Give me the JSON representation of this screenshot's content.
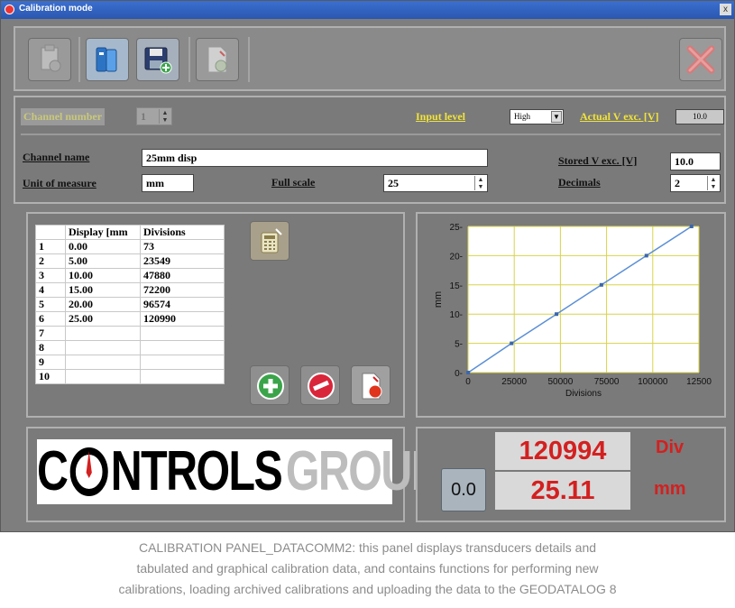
{
  "window": {
    "title": "Calibration mode",
    "close_glyph": "x"
  },
  "toolbar": {
    "buttons": [
      {
        "name": "calibration-sheet-icon",
        "enabled": false
      },
      {
        "name": "archive-folder-icon",
        "enabled": true
      },
      {
        "name": "save-disk-icon",
        "enabled": true
      },
      {
        "name": "upload-document-icon",
        "enabled": false
      },
      {
        "name": "close-x-icon",
        "enabled": false
      }
    ]
  },
  "params": {
    "channel_number_label": "Channel number",
    "channel_number_value": "1",
    "input_level_label": "Input level",
    "input_level_value": "High",
    "actual_vexc_label": "Actual V exc. [V]",
    "actual_vexc_value": "10.0",
    "channel_name_label": "Channel name",
    "channel_name_value": "25mm disp",
    "unit_label": "Unit of measure",
    "unit_value": "mm",
    "full_scale_label": "Full scale",
    "full_scale_value": "25",
    "stored_vexc_label": "Stored V exc. [V]",
    "stored_vexc_value": "10.0",
    "decimals_label": "Decimals",
    "decimals_value": "2"
  },
  "table": {
    "headers": [
      "",
      "Display [mm",
      "Divisions"
    ],
    "rows": [
      [
        "1",
        "0.00",
        "73"
      ],
      [
        "2",
        "5.00",
        "23549"
      ],
      [
        "3",
        "10.00",
        "47880"
      ],
      [
        "4",
        "15.00",
        "72200"
      ],
      [
        "5",
        "20.00",
        "96574"
      ],
      [
        "6",
        "25.00",
        "120990"
      ],
      [
        "7",
        "",
        ""
      ],
      [
        "8",
        "",
        ""
      ],
      [
        "9",
        "",
        ""
      ],
      [
        "10",
        "",
        ""
      ]
    ]
  },
  "chart_data": {
    "type": "line",
    "x": [
      73,
      23549,
      47880,
      72200,
      96574,
      120990
    ],
    "y": [
      0,
      5,
      10,
      15,
      20,
      25
    ],
    "xlabel": "Divisions",
    "ylabel": "mm",
    "xlim": [
      0,
      125000
    ],
    "ylim": [
      0,
      25
    ],
    "xticks": [
      "0",
      "25000",
      "50000",
      "75000",
      "100000",
      "12500"
    ],
    "yticks": [
      "0",
      "5",
      "10",
      "15",
      "20",
      "25"
    ],
    "grid": true,
    "colors": {
      "line": "#5b8fd6",
      "grid": "#d8d34a",
      "background": "#ffffff"
    }
  },
  "logo": {
    "word1": "C",
    "word2": "NTROLS",
    "word3": "GROUP"
  },
  "readout": {
    "zero_button": "0.0",
    "div_value": "120994",
    "div_unit": "Div",
    "mm_value": "25.11",
    "mm_unit": "mm"
  },
  "caption": {
    "lines": [
      "CALIBRATION PANEL_DATACOMM2: this panel displays transducers details and",
      "tabulated and graphical calibration data, and contains functions for performing new",
      "calibrations, loading archived calibrations and uploading the data to the GEODATALOG 8"
    ]
  }
}
